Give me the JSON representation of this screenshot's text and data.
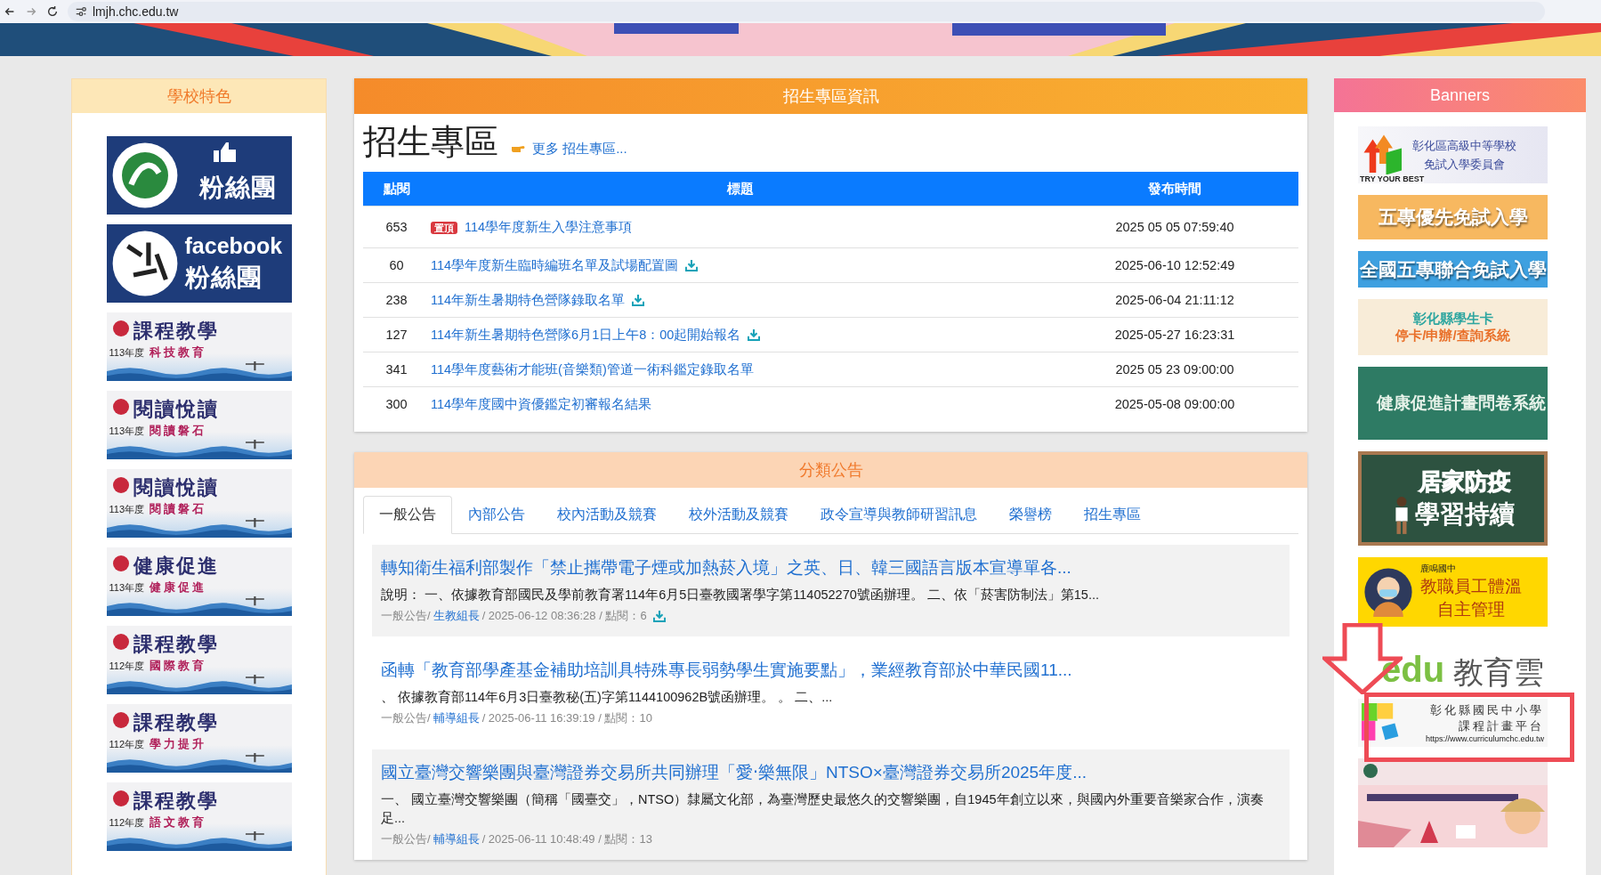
{
  "browser": {
    "url": "lmjh.chc.edu.tw"
  },
  "left_panel": {
    "title": "學校特色",
    "banners": [
      {
        "kind": "fan",
        "lines": [
          "粉絲團"
        ]
      },
      {
        "kind": "fb",
        "lines": [
          "facebook",
          "粉絲團"
        ]
      },
      {
        "kind": "course",
        "lines": [
          "課程教學",
          "科技教育",
          "113年度"
        ]
      },
      {
        "kind": "course",
        "lines": [
          "閱讀悅讀",
          "閱讀磐石",
          "113年度"
        ]
      },
      {
        "kind": "course",
        "lines": [
          "閱讀悅讀",
          "閱讀磐石",
          "113年度"
        ]
      },
      {
        "kind": "course",
        "lines": [
          "健康促進",
          "健康促進",
          "113年度"
        ]
      },
      {
        "kind": "course",
        "lines": [
          "課程教學",
          "國際教育",
          "112年度"
        ]
      },
      {
        "kind": "course",
        "lines": [
          "課程教學",
          "學力提升",
          "112年度"
        ]
      },
      {
        "kind": "course",
        "lines": [
          "課程教學",
          "語文教育",
          "112年度"
        ]
      }
    ]
  },
  "admissions": {
    "header": "招生專區資訊",
    "title": "招生專區",
    "more_link": "更多 招生專區...",
    "table": {
      "columns": [
        "點閱",
        "標題",
        "發布時間"
      ],
      "rows": [
        {
          "views": "653",
          "badge": "置頂",
          "title": "114學年度新生入學注意事項",
          "download": false,
          "date": "2025 05 05 07:59:40"
        },
        {
          "views": "60",
          "title": "114學年度新生臨時編班名單及試場配置圖",
          "download": true,
          "date": "2025-06-10 12:52:49"
        },
        {
          "views": "238",
          "title": "114年新生暑期特色營隊錄取名單",
          "download": true,
          "date": "2025-06-04 21:11:12"
        },
        {
          "views": "127",
          "title": "114年新生暑期特色營隊6月1日上午8：00起開始報名",
          "download": true,
          "date": "2025-05-27 16:23:31"
        },
        {
          "views": "341",
          "title": "114學年度藝術才能班(音樂類)管道一術科鑑定錄取名單",
          "download": false,
          "date": "2025 05 23 09:00:00"
        },
        {
          "views": "300",
          "title": "114學年度國中資優鑑定初審報名結果",
          "download": false,
          "date": "2025-05-08 09:00:00"
        }
      ]
    }
  },
  "announcements": {
    "header": "分類公告",
    "tabs": [
      {
        "label": "一般公告",
        "selected": true
      },
      {
        "label": "內部公告",
        "selected": false
      },
      {
        "label": "校內活動及競賽",
        "selected": false
      },
      {
        "label": "校外活動及競賽",
        "selected": false
      },
      {
        "label": "政令宣導與教師研習訊息",
        "selected": false
      },
      {
        "label": "榮譽榜",
        "selected": false
      },
      {
        "label": "招生專區",
        "selected": false
      }
    ],
    "items": [
      {
        "shaded": true,
        "title": "轉知衛生福利部製作「禁止攜帶電子煙或加熱菸入境」之英、日、韓三國語言版本宣導單各...",
        "summary": "說明： 一、依據教育部國民及學前教育署114年6月5日臺教國署學字第114052270號函辦理。 二、依「菸害防制法」第15...",
        "category": "一般公告/",
        "author": "生教組長",
        "meta": "/ 2025-06-12 08:36:28 / 點閱：6",
        "download": true
      },
      {
        "shaded": false,
        "title": "函轉「教育部學產基金補助培訓具特殊專長弱勢學生實施要點」，業經教育部於中華民國11...",
        "summary": "、 依據教育部114年6月3日臺教秘(五)字第1144100962B號函辦理。 。 二、...",
        "category": "一般公告/",
        "author": "輔導組長",
        "meta": "/ 2025-06-11 16:39:19 / 點閱：10",
        "download": false
      },
      {
        "shaded": true,
        "title": "國立臺灣交響樂團與臺灣證券交易所共同辦理「愛‧樂無限」NTSO×臺灣證券交易所2025年度...",
        "summary": "一、 國立臺灣交響樂團（簡稱「國臺交」，NTSO）隸屬文化部，為臺灣歷史最悠久的交響樂團，自1945年創立以來，與國內外重要音樂家合作，演奏足...",
        "category": "一般公告/",
        "author": "輔導組長",
        "meta": "/ 2025-06-11 10:48:49 / 點閱：13",
        "download": false
      }
    ]
  },
  "right_panel": {
    "title": "Banners",
    "banners": [
      {
        "kind": "committee",
        "lines": [
          "彰化區高級中等學校",
          "免試入學委員會",
          "TRY YOUR BEST"
        ]
      },
      {
        "kind": "orange",
        "lines": [
          "五專優先免試入學"
        ]
      },
      {
        "kind": "blue",
        "lines": [
          "全國五專聯合免試入學"
        ]
      },
      {
        "kind": "card",
        "lines": [
          "彰化縣學生卡",
          "停卡/申辦/查詢系統"
        ]
      },
      {
        "kind": "green",
        "lines": [
          "健康促進計畫問卷系統"
        ]
      },
      {
        "kind": "chalk",
        "lines": [
          "居家防疫",
          "學習持續"
        ]
      },
      {
        "kind": "yellow",
        "lines": [
          "鹿鳴國中",
          "教職員工體溫",
          "自主管理"
        ]
      },
      {
        "kind": "edu",
        "lines": [
          "edu",
          "教育雲"
        ]
      },
      {
        "kind": "puzzle",
        "lines": [
          "彰化縣國民中小學",
          "課程計畫平台",
          "https://www.curriculumchc.edu.tw"
        ]
      },
      {
        "kind": "picture"
      }
    ]
  }
}
